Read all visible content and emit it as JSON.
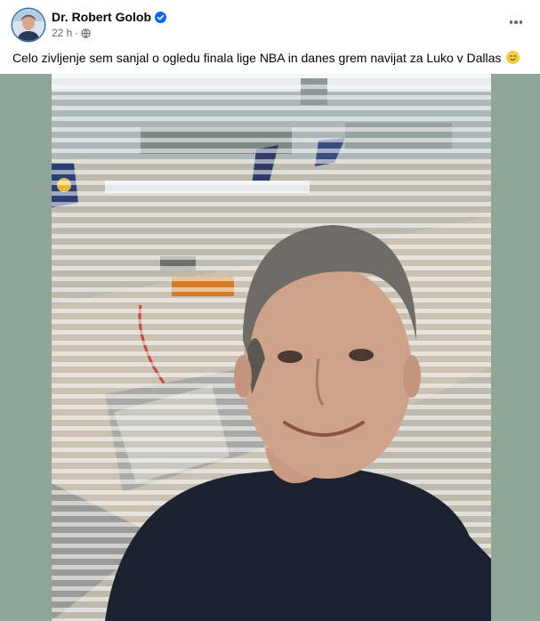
{
  "post": {
    "author": "Dr. Robert Golob",
    "verified": true,
    "timestamp": "22 h",
    "separator": "·",
    "caption": "Celo zivljenje sem sanjal o ogledu finala lige NBA in danes grem navijat za Luko v Dallas",
    "caption_emoji": "smiling-emoji"
  },
  "colors": {
    "media_background": "#8ea598",
    "verified_badge": "#0866ff",
    "meta_text": "#65676b"
  },
  "icons": {
    "verified": "verified-badge-icon",
    "privacy": "globe-icon",
    "more": "more-options-icon"
  }
}
